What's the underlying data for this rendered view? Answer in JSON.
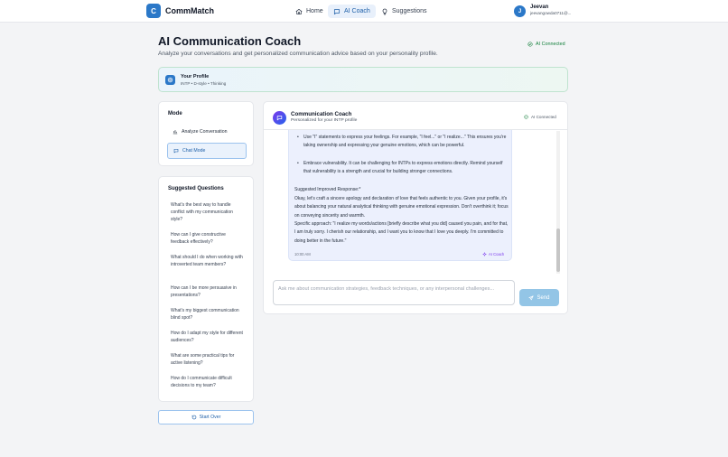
{
  "app": {
    "logo_letter": "C",
    "name": "CommMatch"
  },
  "nav": [
    {
      "label": "Home",
      "icon": "home-icon"
    },
    {
      "label": "AI Coach",
      "icon": "chat-bubble-icon",
      "active": true
    },
    {
      "label": "Suggestions",
      "icon": "lightbulb-icon"
    }
  ],
  "user": {
    "initial": "J",
    "name": "Jeevan",
    "email": "jeevangowda0711@..."
  },
  "page": {
    "title": "AI Communication Coach",
    "subtitle": "Analyze your conversations and get personalized communication advice based on your personality profile.",
    "status": "AI Connected"
  },
  "profile": {
    "title": "Your Profile",
    "meta": "INTP • D-style • Thinking"
  },
  "mode": {
    "title": "Mode",
    "options": [
      {
        "label": "Analyze Conversation",
        "icon": "bar-chart-icon",
        "active": false
      },
      {
        "label": "Chat Mode",
        "icon": "chat-bubble-icon",
        "active": true
      }
    ]
  },
  "suggested": {
    "title": "Suggested Questions",
    "items": [
      "What's the best way to handle conflict with my communication style?",
      "How can I give constructive feedback effectively?",
      "What should I do when working with introverted team members?",
      "How can I be more persuasive in presentations?",
      "What's my biggest communication blind spot?",
      "How do I adapt my style for different audiences?",
      "What are some practical tips for active listening?",
      "How do I communicate difficult decisions to my team?"
    ]
  },
  "start_over": "Start Over",
  "chat": {
    "title": "Communication Coach",
    "subtitle": "Personalized for your INTP profile",
    "status": "AI Connected",
    "message": {
      "bullets": [
        "Use \"I\" statements to express your feelings. For example, \"I feel...\" or \"I realize...\" This ensures you're taking ownership and expressing your genuine emotions, which can be powerful.",
        "Embrace vulnerability. It can be challenging for INTPs to express emotions directly. Remind yourself that vulnerability is a strength and crucial for building stronger connections."
      ],
      "heading": "Suggested Improved Response:*",
      "para1": "Okay, let's craft a sincere apology and declaration of love that feels authentic to you. Given your profile, it's about balancing your natural analytical thinking with genuine emotional expression. Don't overthink it; focus on conveying sincerity and warmth.",
      "para2": "Specific approach: \"I realize my words/actions [briefly describe what you did] caused you pain, and for that, I am truly sorry. I cherish our relationship, and I want you to know that I love you deeply. I'm committed to doing better in the future.\"",
      "time": "10:00 AM",
      "tag": "AI Coach"
    },
    "input_placeholder": "Ask me about communication strategies, feedback techniques, or any interpersonal challenges...",
    "send_label": "Send"
  },
  "colors": {
    "primary": "#2b78c8",
    "success": "#15803d",
    "coach_accent": "#7c3aed",
    "bubble": "#ecf0fd"
  }
}
